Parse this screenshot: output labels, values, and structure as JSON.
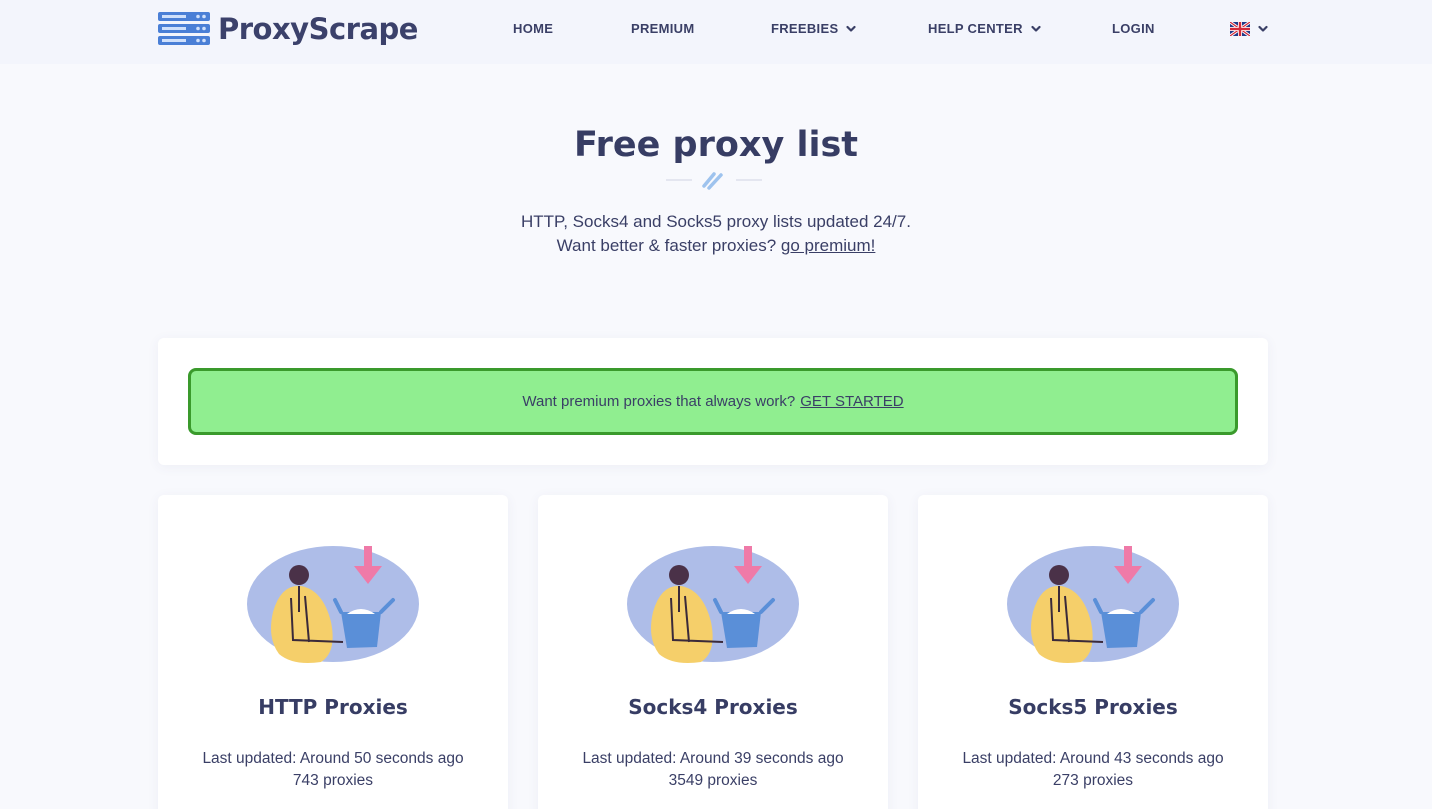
{
  "brand": {
    "name": "ProxyScrape"
  },
  "nav": {
    "home": "HOME",
    "premium": "PREMIUM",
    "freebies": "FREEBIES",
    "help_center": "HELP CENTER",
    "login": "LOGIN",
    "language_icon": "uk-flag-icon"
  },
  "hero": {
    "title": "Free proxy list",
    "line1": "HTTP, Socks4 and Socks5 proxy lists updated 24/7.",
    "line2": "Want better & faster proxies?",
    "premium_link": "go premium!"
  },
  "banner": {
    "text": "Want premium proxies that always work?",
    "link": "GET STARTED",
    "colors": {
      "background": "#90ee90",
      "border": "#3a9a2c"
    }
  },
  "cards": [
    {
      "title": "HTTP Proxies",
      "updated": "Last updated: Around 50 seconds ago",
      "count": "743 proxies"
    },
    {
      "title": "Socks4 Proxies",
      "updated": "Last updated: Around 39 seconds ago",
      "count": "3549 proxies"
    },
    {
      "title": "Socks5 Proxies",
      "updated": "Last updated: Around 43 seconds ago",
      "count": "273 proxies"
    }
  ],
  "colors": {
    "text_dark": "#373d64",
    "accent_blue": "#4a7fd6",
    "pink_arrow": "#ef7aa8",
    "person_yellow": "#f5cf6a",
    "blob_blue": "#aebde8"
  }
}
